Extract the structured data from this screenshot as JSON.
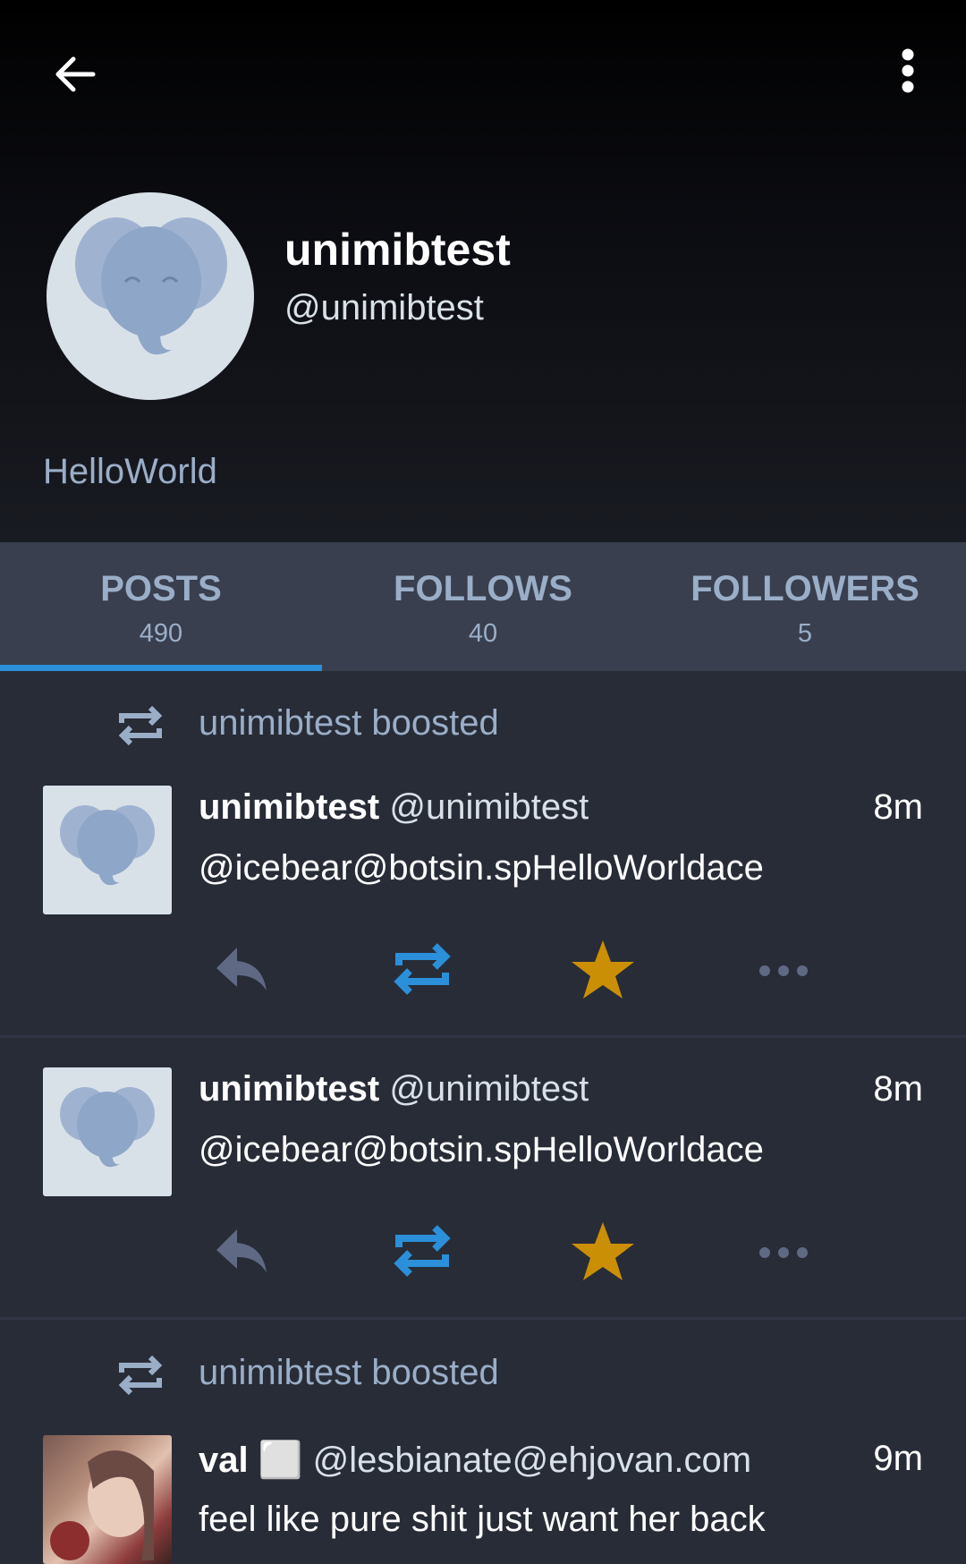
{
  "profile": {
    "display_name": "unimibtest",
    "handle": "@unimibtest",
    "bio": "HelloWorld"
  },
  "tabs": [
    {
      "label": "POSTS",
      "count": "490",
      "active": true
    },
    {
      "label": "FOLLOWS",
      "count": "40",
      "active": false
    },
    {
      "label": "FOLLOWERS",
      "count": "5",
      "active": false
    }
  ],
  "feed": {
    "boost_1": "unimibtest boosted",
    "post_1": {
      "name": "unimibtest",
      "handle": "@unimibtest",
      "time": "8m",
      "text": "@icebear@botsin.spHelloWorldace"
    },
    "post_2": {
      "name": "unimibtest",
      "handle": "@unimibtest",
      "time": "8m",
      "text": "@icebear@botsin.spHelloWorldace"
    },
    "boost_2": "unimibtest boosted",
    "post_3": {
      "name": "val ⬜",
      "handle": "@lesbianate@ehjovan.com",
      "time": "9m",
      "text": "feel like pure shit just want her back"
    }
  },
  "icons": {
    "back": "arrow-left-icon",
    "menu": "more-vertical-icon",
    "boost": "repeat-icon",
    "reply": "reply-icon",
    "favourite": "star-icon",
    "more": "more-horizontal-icon"
  },
  "colors": {
    "accent": "#2b90d9",
    "favourite": "#ca8f04",
    "muted": "#9baec8",
    "action_grey": "#606984",
    "background": "#282c37",
    "tab_bar": "#393f4f"
  }
}
